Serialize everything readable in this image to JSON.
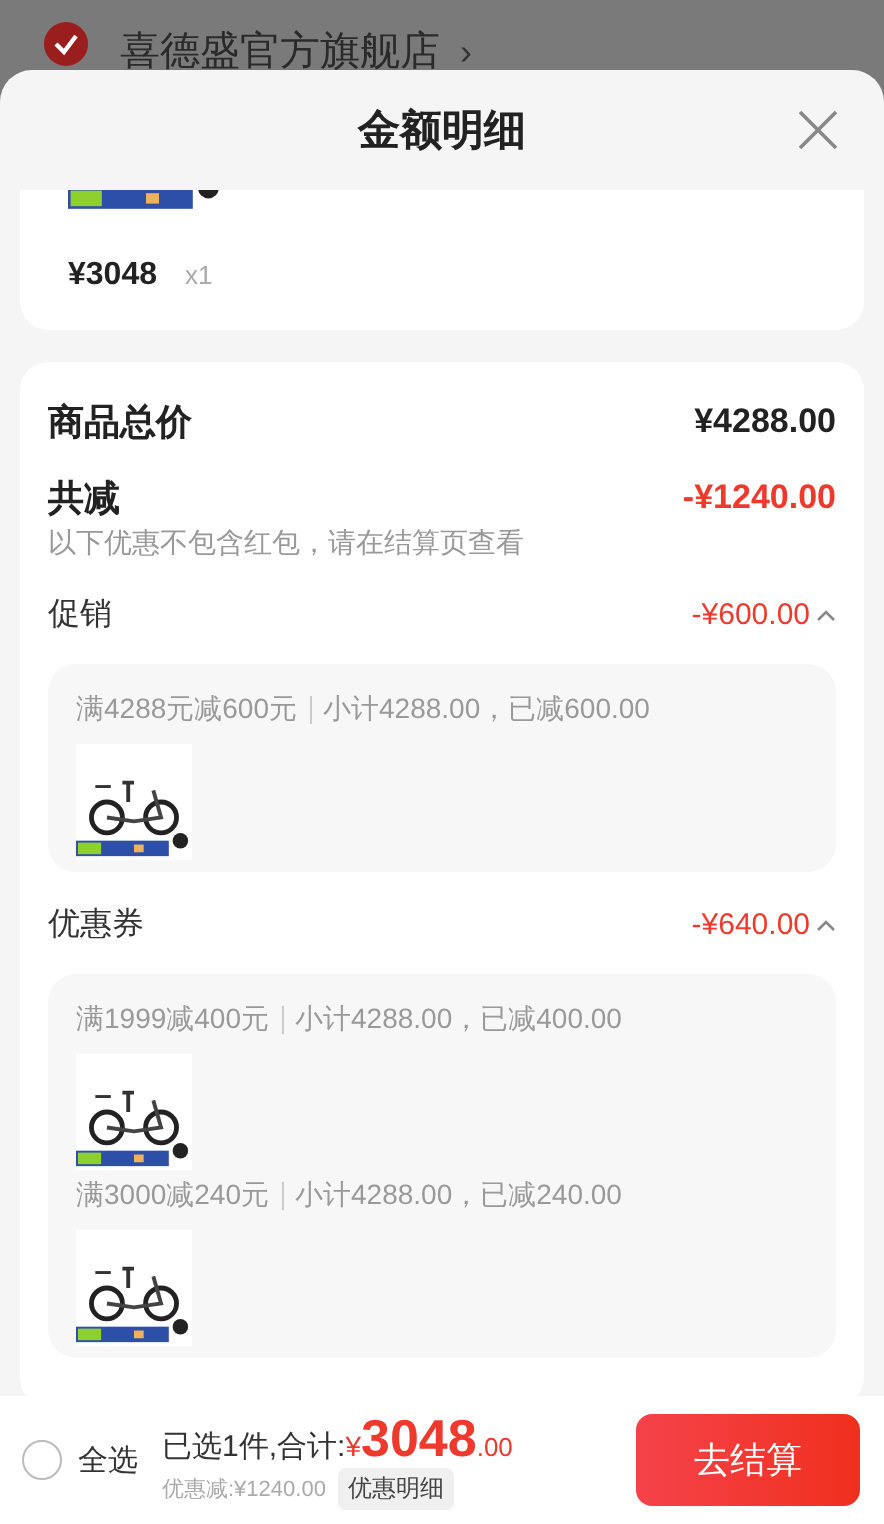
{
  "backdrop": {
    "store_name": "喜德盛官方旗舰店",
    "chevron": "›",
    "checked": true
  },
  "sheet": {
    "title": "金额明细"
  },
  "product": {
    "price": "¥3048",
    "quantity": "x1"
  },
  "summary": {
    "total_label": "商品总价",
    "total_value": "¥4288.00",
    "reduce_label": "共减",
    "reduce_value": "-¥1240.00",
    "note": "以下优惠不包含红包，请在结算页查看"
  },
  "sections": [
    {
      "label": "促销",
      "amount": "-¥600.00",
      "expanded": true,
      "items": [
        {
          "rule": "满4288元减600元",
          "detail": "小计4288.00，已减600.00"
        }
      ]
    },
    {
      "label": "优惠券",
      "amount": "-¥640.00",
      "expanded": true,
      "items": [
        {
          "rule": "满1999减400元",
          "detail": "小计4288.00，已减400.00"
        },
        {
          "rule": "满3000减240元",
          "detail": "小计4288.00，已减240.00"
        }
      ]
    }
  ],
  "footer": {
    "select_all": "全选",
    "selected": false,
    "count_text": "已选1件,合计:",
    "currency": "¥",
    "price_int": "3048",
    "price_dec": ".00",
    "discount": "优惠减:¥1240.00",
    "detail_button": "优惠明细",
    "checkout": "去结算"
  }
}
